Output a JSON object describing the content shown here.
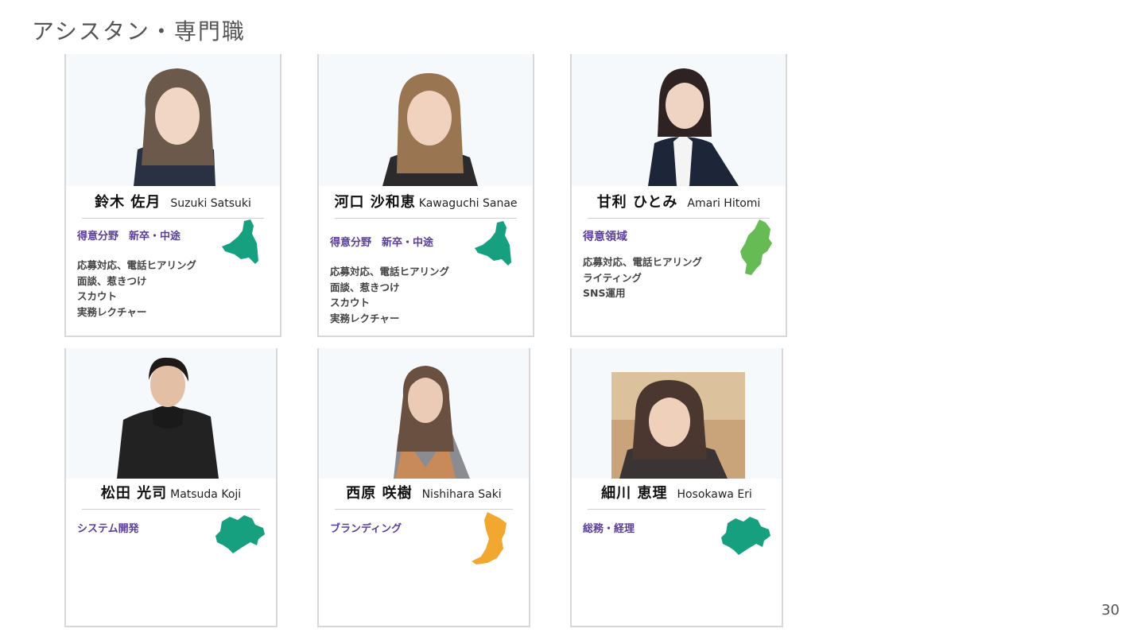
{
  "header": {
    "title": "アシスタン・専門職"
  },
  "footer": {
    "page_number": "30"
  },
  "colors": {
    "specialty_text": "#5a3e9a",
    "map_teal": "#17a07f",
    "map_green": "#66bb55",
    "map_orange": "#f2a830",
    "photo_bg": "#f6f9fc"
  },
  "staff": [
    {
      "name_ja": "鈴木 佐月",
      "name_en": "Suzuki Satsuki",
      "specialty": "得意分野　新卒・中途",
      "duties": [
        "応募対応、電話ヒアリング",
        "面談、惹きつけ",
        "スカウト",
        "実務レクチャー"
      ],
      "map_icon": "chiba-map-icon"
    },
    {
      "name_ja": "河口 沙和恵",
      "name_en": "Kawaguchi Sanae",
      "specialty": "得意分野　新卒・中途",
      "duties": [
        "応募対応、電話ヒアリング",
        "面談、惹きつけ",
        "スカウト",
        "実務レクチャー"
      ],
      "map_icon": "chiba-map-icon"
    },
    {
      "name_ja": "甘利 ひとみ",
      "name_en": "Amari Hitomi",
      "specialty": "得意領域",
      "duties": [
        "応募対応、電話ヒアリング",
        "ライティング",
        "SNS運用"
      ],
      "map_icon": "nagano-map-icon"
    },
    {
      "name_ja": "松田 光司",
      "name_en": "Matsuda Koji",
      "specialty": "システム開発",
      "duties": [],
      "map_icon": "kanagawa-map-icon"
    },
    {
      "name_ja": "西原 咲樹",
      "name_en": "Nishihara Saki",
      "specialty": "ブランディング",
      "duties": [],
      "map_icon": "osaka-map-icon"
    },
    {
      "name_ja": "細川 恵理",
      "name_en": "Hosokawa Eri",
      "specialty": "総務・経理",
      "duties": [],
      "map_icon": "kanagawa-map-icon"
    }
  ]
}
